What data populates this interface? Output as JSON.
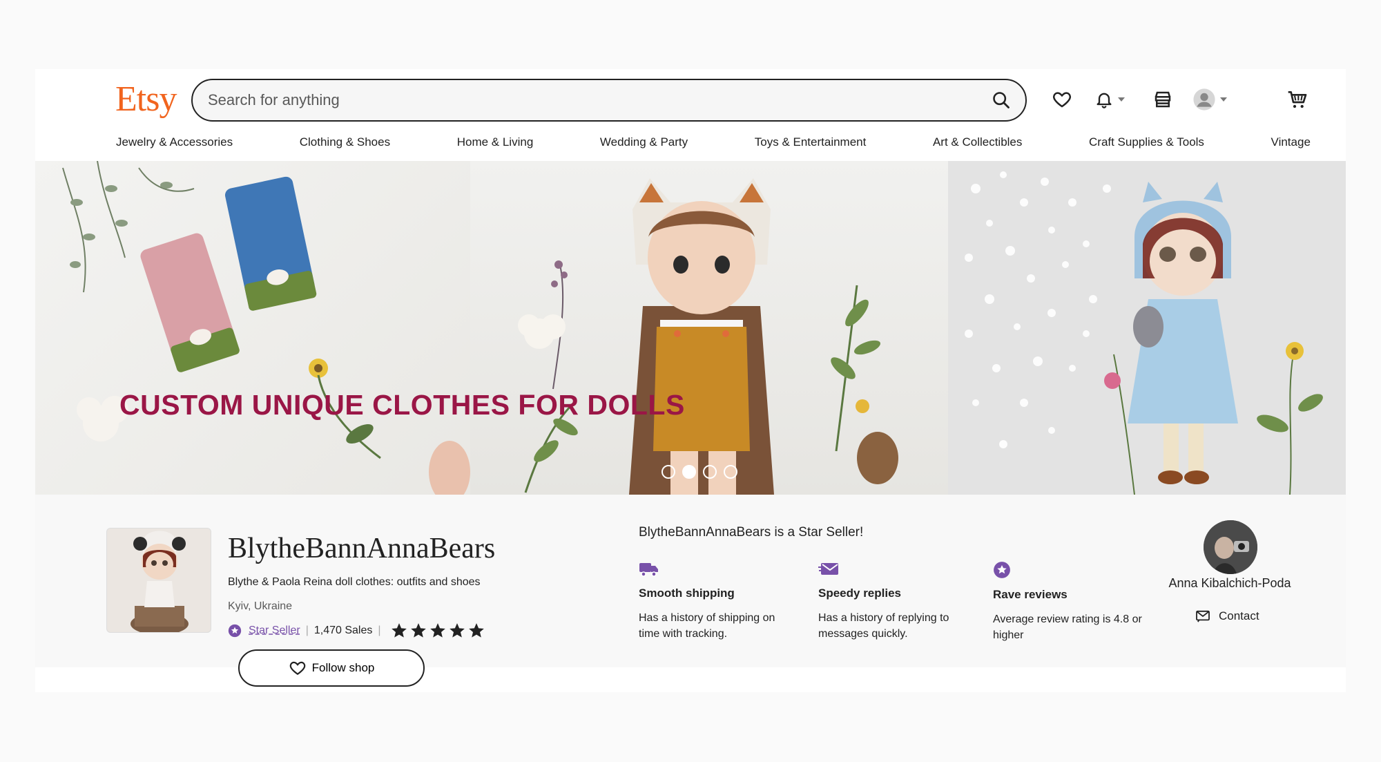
{
  "header": {
    "logo": "Etsy",
    "search_placeholder": "Search for anything",
    "categories": [
      "Jewelry & Accessories",
      "Clothing & Shoes",
      "Home & Living",
      "Wedding & Party",
      "Toys & Entertainment",
      "Art & Collectibles",
      "Craft Supplies & Tools",
      "Vintage"
    ]
  },
  "banner": {
    "caption": "CUSTOM UNIQUE CLOTHES FOR DOLLS",
    "slide_count": 4,
    "active_slide": 2
  },
  "shop": {
    "name": "BlytheBannAnnaBears",
    "tagline": "Blythe & Paola Reina doll clothes: outfits and shoes",
    "location": "Kyiv, Ukraine",
    "star_seller_label": "Star Seller",
    "sales": "1,470 Sales",
    "rating_stars": 5,
    "follow_label": "Follow shop"
  },
  "star_seller": {
    "title": "BlytheBannAnnaBears is a Star Seller!",
    "features": [
      {
        "icon": "truck-icon",
        "title": "Smooth shipping",
        "desc": "Has a history of shipping on time with tracking."
      },
      {
        "icon": "message-icon",
        "title": "Speedy replies",
        "desc": "Has a history of replying to messages quickly."
      },
      {
        "icon": "star-badge-icon",
        "title": "Rave reviews",
        "desc": "Average review rating is 4.8 or higher"
      }
    ]
  },
  "owner": {
    "name": "Anna Kibalchich-Poda",
    "contact_label": "Contact"
  },
  "colors": {
    "brand": "#f1641e",
    "star_seller": "#7851a9",
    "banner_text": "#9a1646"
  }
}
